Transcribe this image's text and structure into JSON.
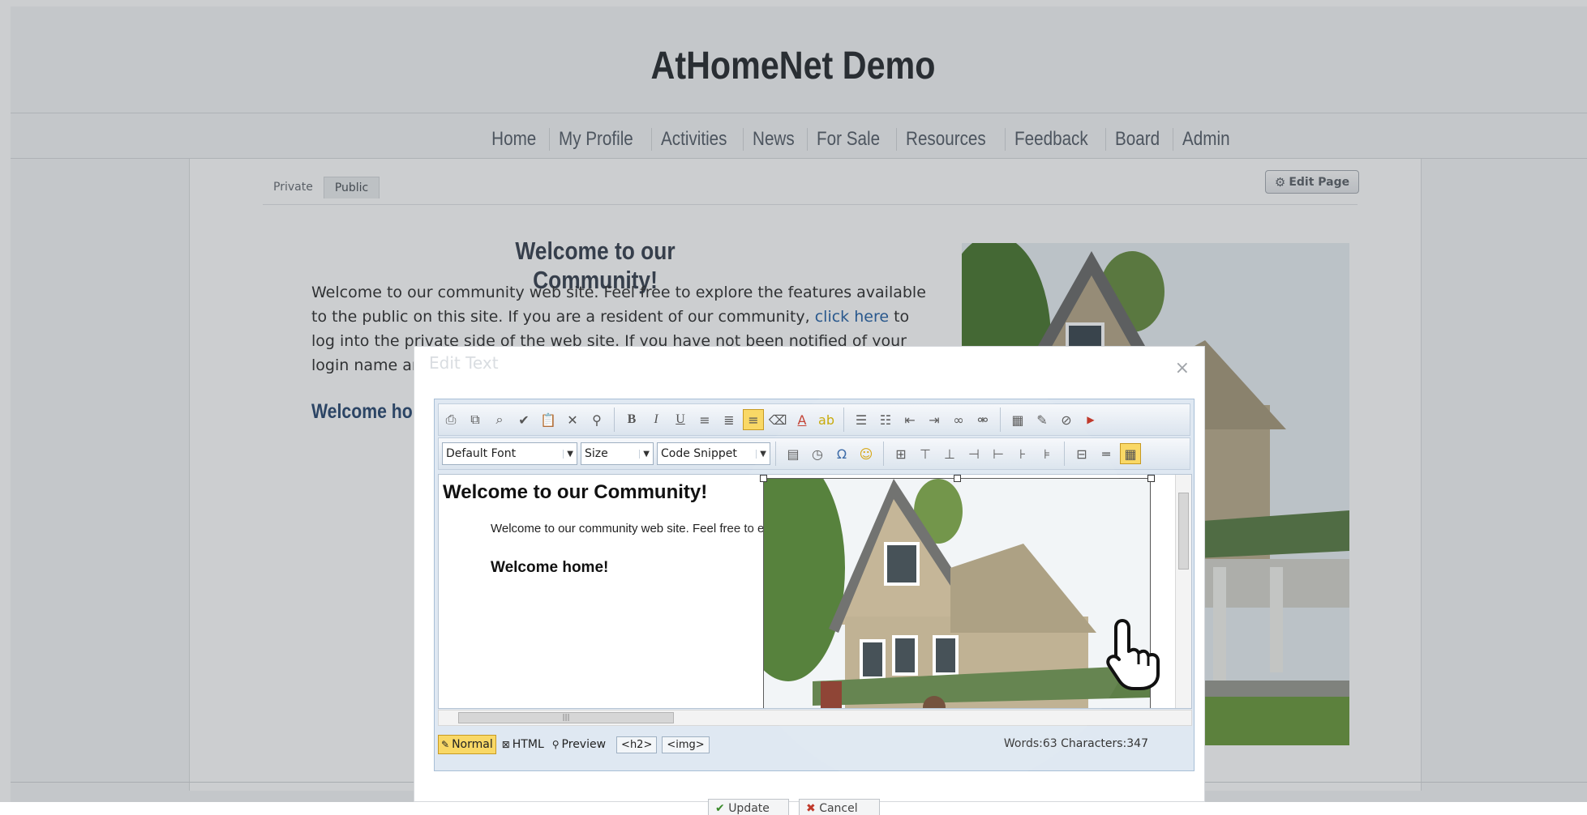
{
  "site": {
    "title": "AtHomeNet Demo"
  },
  "nav": {
    "items": [
      "Home",
      "My Profile",
      "Activities",
      "News",
      "For Sale",
      "Resources",
      "Feedback",
      "Board",
      "Admin"
    ]
  },
  "tabs": {
    "private": "Private",
    "public": "Public",
    "active": "Public"
  },
  "edit_page": {
    "label": "Edit Page",
    "icon": "gear-icon"
  },
  "content": {
    "heading": "Welcome to our Community!",
    "para_line1": "Welcome to our community web site. Feel free to explore the features available",
    "para_line2": "to the public on this site. If you are a resident of our community, ",
    "para_link": "click here",
    "para_line2b": " to",
    "para_line3": "log into the private side of the web site. If you have not been notified of your",
    "para_line4": "login name ar",
    "subheading": "Welcome home"
  },
  "dialog": {
    "title": "Edit Text",
    "close_icon": "close-icon",
    "font_select": "Default Font",
    "size_select": "Size",
    "snippet_select": "Code Snippet",
    "editor_heading": "Welcome to our Community!",
    "editor_para": "Welcome to our community web site. Feel free to explore the features available to the public on this site. If",
    "editor_subheading": "Welcome home!",
    "modes": {
      "normal": "Normal",
      "html": "HTML",
      "preview": "Preview",
      "active": "Normal"
    },
    "tags": [
      "<h2>",
      "<img>"
    ],
    "counts": "Words:63 Characters:347",
    "buttons": {
      "update": "Update",
      "cancel": "Cancel"
    }
  },
  "colors": {
    "accent_active": "#f9d866",
    "link": "#2a65a8",
    "heading": "#3b4452"
  }
}
